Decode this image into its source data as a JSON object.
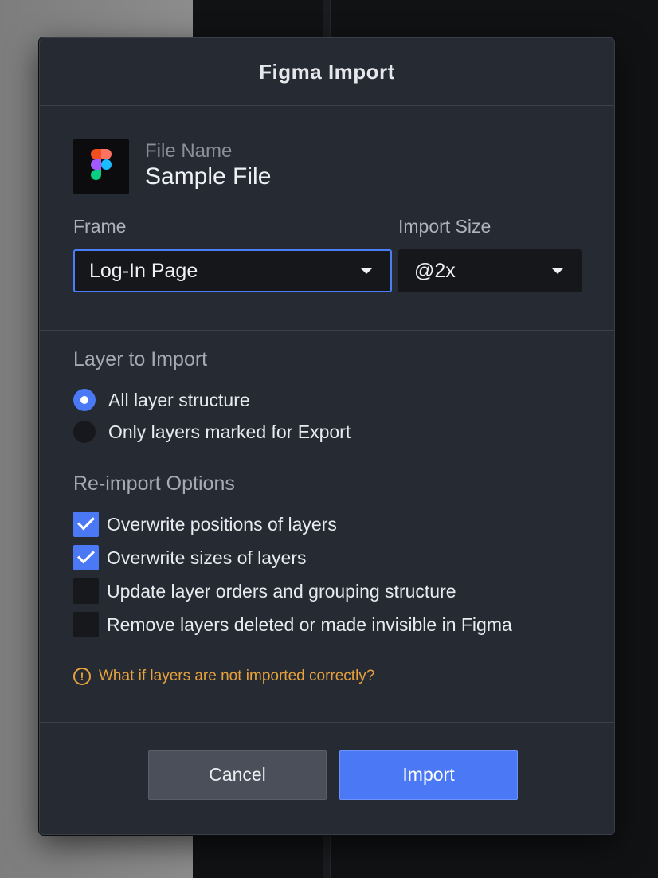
{
  "dialog": {
    "title": "Figma Import"
  },
  "file": {
    "label": "File Name",
    "name": "Sample File",
    "icon": "figma-logo-icon"
  },
  "frame": {
    "label": "Frame",
    "value": "Log-In Page"
  },
  "import_size": {
    "label": "Import Size",
    "value": "@2x"
  },
  "layer_to_import": {
    "title": "Layer to Import",
    "options": [
      {
        "label": "All layer structure",
        "selected": true
      },
      {
        "label": "Only layers marked for Export",
        "selected": false
      }
    ]
  },
  "reimport_options": {
    "title": "Re-import Options",
    "options": [
      {
        "label": "Overwrite positions of layers",
        "checked": true
      },
      {
        "label": "Overwrite sizes of layers",
        "checked": true
      },
      {
        "label": "Update layer orders and grouping structure",
        "checked": false
      },
      {
        "label": "Remove layers deleted or made invisible in Figma",
        "checked": false
      }
    ]
  },
  "help": {
    "icon": "warning-circle-icon",
    "text": "What if layers are not imported correctly?"
  },
  "buttons": {
    "cancel": "Cancel",
    "import": "Import"
  },
  "colors": {
    "accent": "#4b78f5",
    "warning": "#e8a23c",
    "dialog_bg": "#262a33"
  }
}
